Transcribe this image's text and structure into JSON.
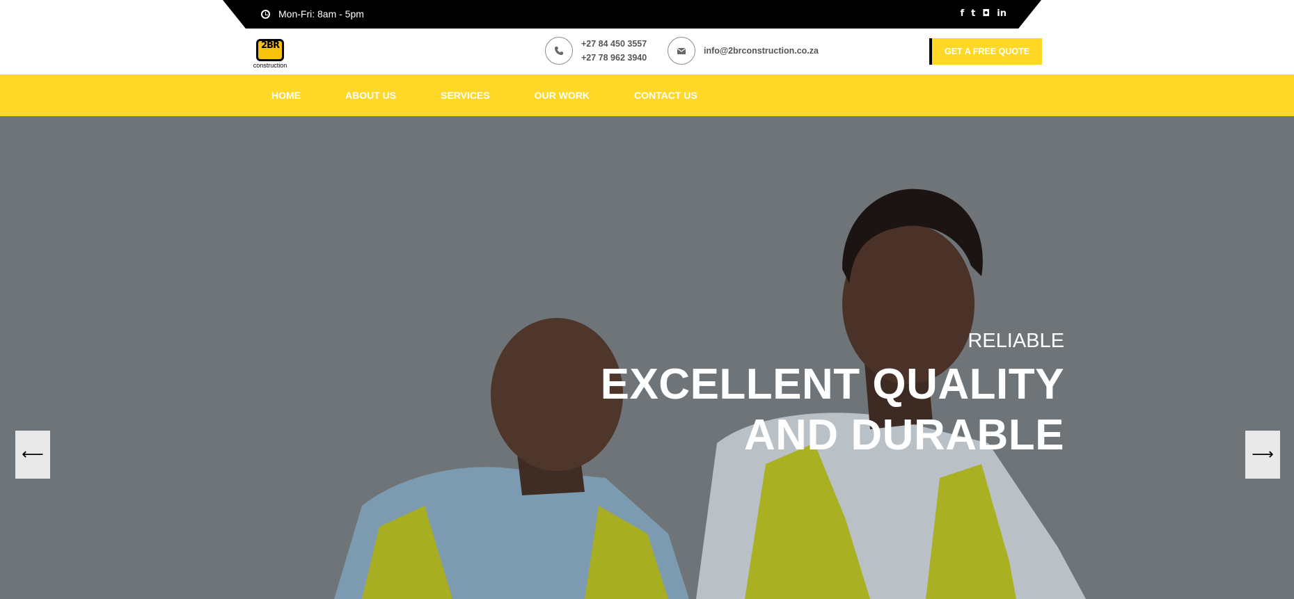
{
  "topbar": {
    "hours": "Mon-Fri: 8am - 5pm",
    "social": [
      {
        "icon": "facebook-icon",
        "glyph": "f"
      },
      {
        "icon": "twitter-icon",
        "glyph": "t"
      },
      {
        "icon": "instagram-icon",
        "glyph": "◘"
      },
      {
        "icon": "linkedin-icon",
        "glyph": "in"
      }
    ]
  },
  "header": {
    "logo": {
      "mark": "2BR",
      "text": "construction"
    },
    "phones": [
      "+27 84 450 3557",
      "+27 78 962 3940"
    ],
    "email": "info@2brconstruction.co.za",
    "quote_label": "GET A FREE QUOTE"
  },
  "nav": {
    "items": [
      "HOME",
      "ABOUT US",
      "SERVICES",
      "OUR WORK",
      "CONTACT US"
    ]
  },
  "hero": {
    "subtitle": "RELIABLE",
    "title_line1": "EXCELLENT QUALITY",
    "title_line2": "AND DURABLE",
    "prev_icon": "arrow-left-icon",
    "next_icon": "arrow-right-icon"
  },
  "colors": {
    "accent": "#ffd726",
    "topbar": "#000000",
    "hero_bg": "#6e7377"
  }
}
